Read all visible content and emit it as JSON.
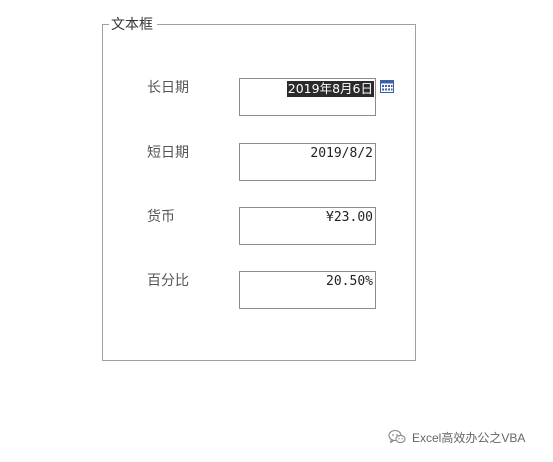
{
  "groupbox": {
    "title": "文本框"
  },
  "fields": [
    {
      "label": "长日期",
      "value": "2019年8月6日",
      "selected": true
    },
    {
      "label": "短日期",
      "value": "2019/8/2"
    },
    {
      "label": "货币",
      "value": "¥23.00"
    },
    {
      "label": "百分比",
      "value": "20.50%"
    }
  ],
  "icons": {
    "date_picker": "calendar-icon",
    "watermark": "wechat-icon"
  },
  "watermark": {
    "text": "Excel高效办公之VBA"
  },
  "colors": {
    "selection_bg": "#2b2b2b",
    "border": "#8c8c8c",
    "calendar_blue": "#3b5fa8"
  }
}
